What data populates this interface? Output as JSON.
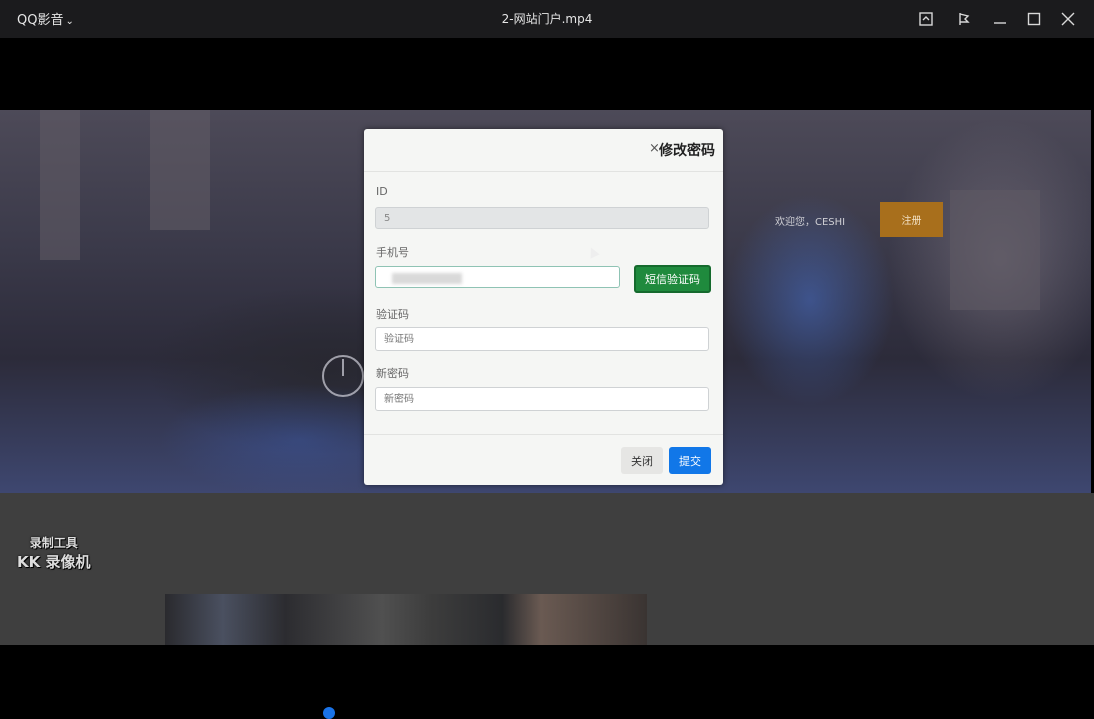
{
  "titlebar": {
    "app_name": "QQ影音",
    "file_name": "2-网站门户.mp4"
  },
  "site": {
    "welcome": "欢迎您，CESHI",
    "register": "注册"
  },
  "modal": {
    "close_symbol": "×",
    "title": "修改密码",
    "id_label": "ID",
    "id_value": "5",
    "phone_label": "手机号",
    "sms_button": "短信验证码",
    "code_label": "验证码",
    "code_placeholder": "验证码",
    "password_label": "新密码",
    "password_placeholder": "新密码",
    "close_button": "关闭",
    "submit_button": "提交"
  },
  "watermark": {
    "line1": "录制工具",
    "line2": "KK 录像机"
  },
  "icons": [
    "chevron-down-icon",
    "screenshot-icon",
    "pin-icon",
    "minimize-icon",
    "maximize-icon",
    "close-icon",
    "mouse-cursor-icon"
  ],
  "colors": {
    "sms_button": "#1f8a3d",
    "submit_button": "#1177e8",
    "register_button": "#a86f1c"
  }
}
